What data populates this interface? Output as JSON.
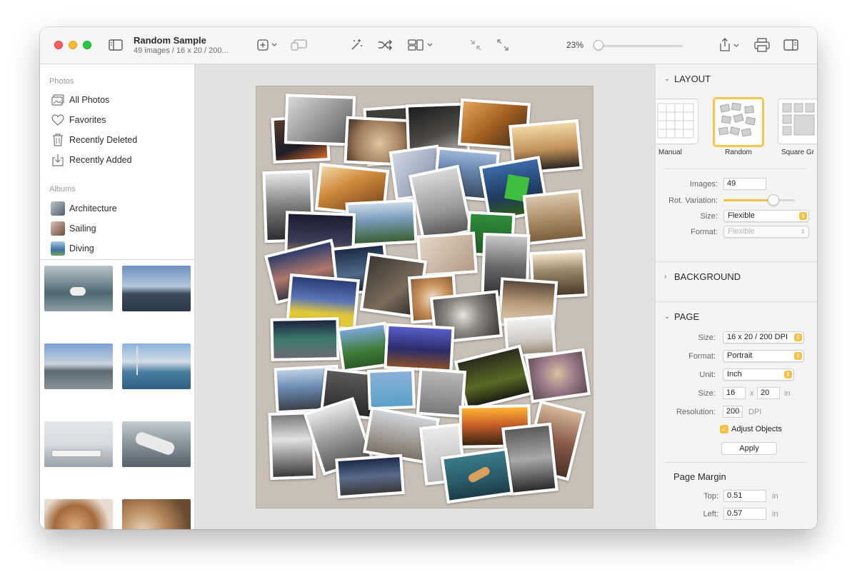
{
  "window": {
    "title": "Random Sample",
    "subtitle": "49 images / 16 x 20 / 200..."
  },
  "toolbar": {
    "zoom_label": "23%",
    "zoom_value": 0.0,
    "icons": [
      "sidebar-toggle-icon",
      "add-icon",
      "slideshow-icon",
      "magic-wand-icon",
      "shuffle-icon",
      "layout-icon",
      "collapse-icon",
      "expand-icon",
      "share-icon",
      "print-icon",
      "inspector-toggle-icon"
    ]
  },
  "sidebar": {
    "photos_header": "Photos",
    "items": [
      {
        "label": "All Photos",
        "icon": "photos-icon"
      },
      {
        "label": "Favorites",
        "icon": "heart-icon"
      },
      {
        "label": "Recently Deleted",
        "icon": "trash-icon"
      },
      {
        "label": "Recently Added",
        "icon": "download-icon"
      }
    ],
    "albums_header": "Albums",
    "albums": [
      {
        "label": "Architecture",
        "color": "#7a8a96"
      },
      {
        "label": "Sailing",
        "color": "#9a7a6a"
      },
      {
        "label": "Diving",
        "color": "#5b89b4"
      }
    ]
  },
  "inspector": {
    "layout_header": "LAYOUT",
    "layouts": [
      {
        "label": "Manual"
      },
      {
        "label": "Random"
      },
      {
        "label": "Square Gr"
      }
    ],
    "images_label": "Images:",
    "images_value": "49",
    "rot_label": "Rot. Variation:",
    "rot_value": 0.7,
    "size_label": "Size:",
    "size_value": "Flexible",
    "format_label": "Format:",
    "format_value": "Flexible",
    "background_header": "BACKGROUND",
    "page_header": "PAGE",
    "page_size_label": "Size:",
    "page_size_value": "16 x 20 / 200 DPI",
    "page_format_label": "Format:",
    "page_format_value": "Portrait",
    "unit_label": "Unit:",
    "unit_value": "Inch",
    "dims_label": "Size:",
    "width_value": "16",
    "x_sep": "x",
    "height_value": "20",
    "dims_unit": "in",
    "res_label": "Resolution:",
    "res_value": "200",
    "res_unit": "DPI",
    "adjust_label": "Adjust Objects",
    "apply_label": "Apply",
    "margin_header": "Page Margin",
    "top_label": "Top:",
    "top_value": "0.51",
    "left_label": "Left:",
    "left_value": "0.57",
    "margin_unit": "in",
    "accent": "#f3c043"
  }
}
